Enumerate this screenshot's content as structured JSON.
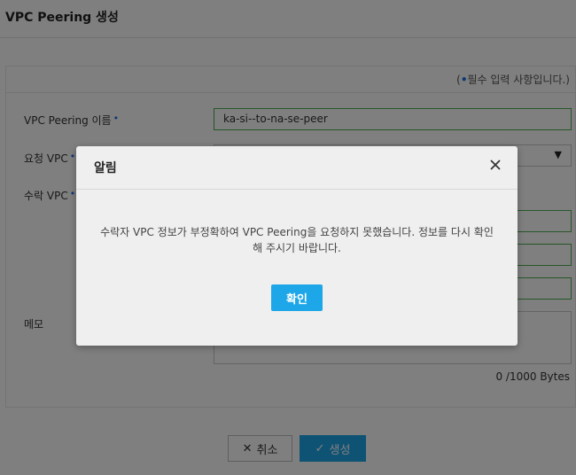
{
  "page": {
    "title": "VPC Peering 생성"
  },
  "form": {
    "required_note_prefix": "(",
    "required_note_dot": "•",
    "required_note_text": "필수 입력 사항입니다.)",
    "fields": {
      "peering_name_label": "VPC Peering 이름",
      "peering_name_value": "ka-si--to-na-se-peer",
      "request_vpc_label": "요청 VPC",
      "accept_vpc_label": "수락 VPC",
      "memo_label": "메모",
      "required_marker": "•"
    },
    "memo_byte_count": "0 /1000 Bytes"
  },
  "footer": {
    "cancel_label": "취소",
    "cancel_icon": "close-icon",
    "create_label": "생성",
    "create_icon": "check-icon"
  },
  "dialog": {
    "title": "알림",
    "message_line1": "수락자 VPC 정보가 부정확하여 VPC Peering을 요청하지 못했습니다. 정보를 다시 확인",
    "message_line2": "해 주시기 바랍니다.",
    "confirm_label": "확인"
  },
  "colors": {
    "accent": "#1ea7e8",
    "required_dot": "#1a73e8",
    "valid_border": "#4caf50"
  }
}
